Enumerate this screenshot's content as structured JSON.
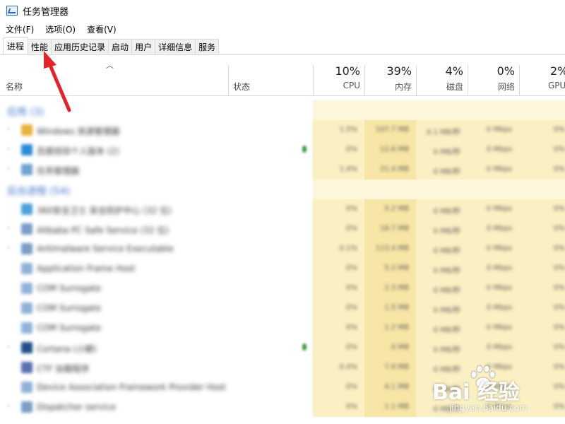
{
  "window": {
    "title": "任务管理器"
  },
  "menu": {
    "items": [
      "文件(F)",
      "选项(O)",
      "查看(V)"
    ]
  },
  "tabs": [
    "进程",
    "性能",
    "应用历史记录",
    "启动",
    "用户",
    "详细信息",
    "服务"
  ],
  "active_tab": "进程",
  "columns": {
    "name": "名称",
    "status": "状态",
    "metrics": [
      {
        "pct": "10%",
        "label": "CPU"
      },
      {
        "pct": "39%",
        "label": "内存"
      },
      {
        "pct": "4%",
        "label": "磁盘"
      },
      {
        "pct": "0%",
        "label": "网络"
      },
      {
        "pct": "2%",
        "label": "GPU"
      }
    ]
  },
  "groups": [
    {
      "label": "应用 (3)",
      "rows": [
        {
          "name": "Windows 资源管理器",
          "icon": "folder-icon",
          "icon_color": "#e8b23a",
          "expand": true,
          "leaf": false,
          "cpu": "1.5%",
          "mem": "107.7 MB",
          "disk": "0.1 MB/秒",
          "net": "0 Mbps",
          "gpu": "0%"
        },
        {
          "name": "百度经验个人版本 (2)",
          "icon": "app-window-icon",
          "icon_color": "#2a8ad8",
          "expand": true,
          "leaf": true,
          "cpu": "0%",
          "mem": "12.6 MB",
          "disk": "0 MB/秒",
          "net": "0 Mbps",
          "gpu": "0%"
        },
        {
          "name": "任务管理器",
          "icon": "task-manager-icon",
          "icon_color": "#6fa3cf",
          "expand": true,
          "leaf": false,
          "cpu": "1.4%",
          "mem": "21.4 MB",
          "disk": "0 MB/秒",
          "net": "0 Mbps",
          "gpu": "0%"
        }
      ]
    },
    {
      "label": "后台进程 (54)",
      "rows": [
        {
          "name": "360安全卫士 安全防护中心 (32 位)",
          "icon": "shield-icon",
          "icon_color": "#4aa0d8",
          "expand": false,
          "leaf": false,
          "cpu": "0%",
          "mem": "5.2 MB",
          "disk": "0 MB/秒",
          "net": "0 Mbps",
          "gpu": "0%"
        },
        {
          "name": "Alibaba PC Safe Service (32 位)",
          "icon": "service-icon",
          "icon_color": "#7a9ec6",
          "expand": true,
          "leaf": false,
          "cpu": "0%",
          "mem": "18.7 MB",
          "disk": "0 MB/秒",
          "net": "0 Mbps",
          "gpu": "0%"
        },
        {
          "name": "Antimalware Service Executable",
          "icon": "service-icon",
          "icon_color": "#7a9ec6",
          "expand": true,
          "leaf": false,
          "cpu": "0.1%",
          "mem": "113.4 MB",
          "disk": "0 MB/秒",
          "net": "0 Mbps",
          "gpu": "0%"
        },
        {
          "name": "Application Frame Host",
          "icon": "window-icon",
          "icon_color": "#8fb3d8",
          "expand": false,
          "leaf": false,
          "cpu": "0%",
          "mem": "5.2 MB",
          "disk": "0 MB/秒",
          "net": "0 Mbps",
          "gpu": "0%"
        },
        {
          "name": "COM Surrogate",
          "icon": "window-icon",
          "icon_color": "#8fb3d8",
          "expand": false,
          "leaf": false,
          "cpu": "0%",
          "mem": "2.3 MB",
          "disk": "0 MB/秒",
          "net": "0 Mbps",
          "gpu": "0%"
        },
        {
          "name": "COM Surrogate",
          "icon": "window-icon",
          "icon_color": "#8fb3d8",
          "expand": false,
          "leaf": false,
          "cpu": "0%",
          "mem": "1.5 MB",
          "disk": "0 MB/秒",
          "net": "0 Mbps",
          "gpu": "0%"
        },
        {
          "name": "COM Surrogate",
          "icon": "window-icon",
          "icon_color": "#8fb3d8",
          "expand": false,
          "leaf": false,
          "cpu": "0%",
          "mem": "1.2 MB",
          "disk": "0 MB/秒",
          "net": "0 Mbps",
          "gpu": "0%"
        },
        {
          "name": "Cortana (小娜)",
          "icon": "cortana-icon",
          "icon_color": "#1f4f8a",
          "expand": true,
          "leaf": true,
          "cpu": "0%",
          "mem": "0 MB",
          "disk": "0 MB/秒",
          "net": "0 Mbps",
          "gpu": "0%"
        },
        {
          "name": "CTF 加载程序",
          "icon": "pen-icon",
          "icon_color": "#5a6fb0",
          "expand": false,
          "leaf": false,
          "cpu": "0.4%",
          "mem": "7.9 MB",
          "disk": "0 MB/秒",
          "net": "0 Mbps",
          "gpu": "0%"
        },
        {
          "name": "Device Association Framework Provider Host",
          "icon": "window-icon",
          "icon_color": "#8fb3d8",
          "expand": false,
          "leaf": false,
          "cpu": "0%",
          "mem": "4.1 MB",
          "disk": "0 MB/秒",
          "net": "0 Mbps",
          "gpu": "0%"
        },
        {
          "name": "Dispatcher service",
          "icon": "service-icon",
          "icon_color": "#7a9ec6",
          "expand": true,
          "leaf": false,
          "cpu": "0%",
          "mem": "1.1 MB",
          "disk": "0 MB/秒",
          "net": "0 Mbps",
          "gpu": "0%"
        }
      ]
    }
  ],
  "colors": {
    "heat_light": "#fdf6db",
    "heat_mid": "#fbf0c3",
    "heat_dark": "#f8e6a6",
    "group_blue": "#3b73c6",
    "arrow_red": "#e3242b"
  },
  "watermark": {
    "main": "Bai 经验",
    "sub": "jingyan.baidu.com"
  }
}
